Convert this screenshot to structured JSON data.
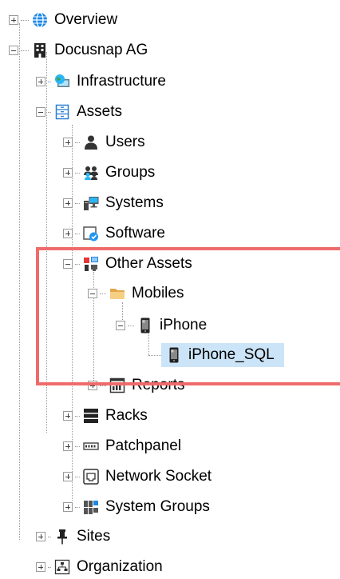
{
  "tree": {
    "overview": "Overview",
    "docusnap": "Docusnap AG",
    "infrastructure": "Infrastructure",
    "assets": "Assets",
    "users": "Users",
    "groups": "Groups",
    "systems": "Systems",
    "software": "Software",
    "other_assets": "Other Assets",
    "mobiles": "Mobiles",
    "iphone": "iPhone",
    "iphone_sql": "iPhone_SQL",
    "reports": "Reports",
    "racks": "Racks",
    "patchpanel": "Patchpanel",
    "network_socket": "Network Socket",
    "system_groups": "System Groups",
    "sites": "Sites",
    "organization": "Organization"
  },
  "colors": {
    "highlight_border": "#ef6b6b",
    "selection_bg": "#cce4f7",
    "globe_blue": "#1e88e5",
    "assets_blue": "#2c7fd1"
  }
}
